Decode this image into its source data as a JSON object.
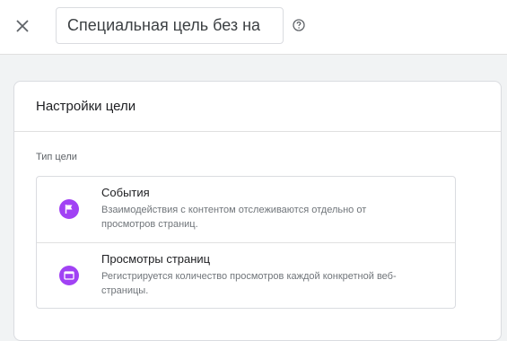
{
  "header": {
    "goal_name_value": "Специальная цель без на",
    "close_icon": "close-icon",
    "help_icon": "help-icon"
  },
  "settings": {
    "title": "Настройки цели",
    "goal_type_label": "Тип цели",
    "options": [
      {
        "title": "События",
        "description": "Взаимодействия с контентом отслеживаются отдельно от просмотров страниц.",
        "icon": "flag-icon"
      },
      {
        "title": "Просмотры страниц",
        "description": "Регистрируется количество просмотров каждой конкретной веб-страницы.",
        "icon": "browser-window-icon"
      }
    ]
  },
  "colors": {
    "option_icon_bg": "#a142f4",
    "page_bg": "#f1f3f4"
  }
}
